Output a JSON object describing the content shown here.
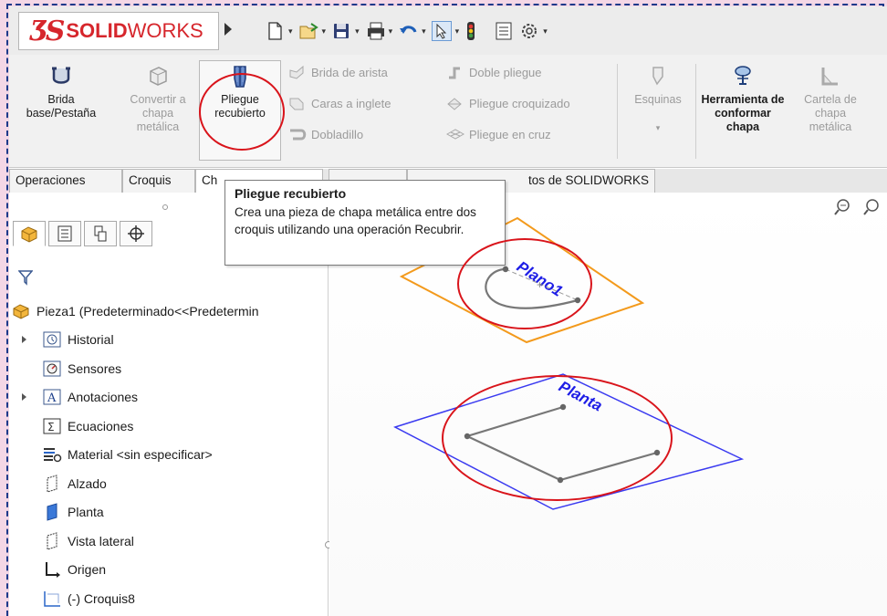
{
  "app": {
    "logo_prefix": "SOLID",
    "logo_suffix": "WORKS"
  },
  "ribbon": {
    "brida_base": "Brida base/Pestaña",
    "convertir": "Convertir a chapa metálica",
    "pliegue_recubierto": "Pliegue recubierto",
    "brida_arista": "Brida de arista",
    "caras_inglete": "Caras a inglete",
    "dobladillo": "Dobladillo",
    "doble_pliegue": "Doble pliegue",
    "pliegue_croquizado": "Pliegue croquizado",
    "pliegue_cruz": "Pliegue en cruz",
    "esquinas": "Esquinas",
    "herramienta": "Herramienta de conformar chapa",
    "cartela": "Cartela de chapa metálica"
  },
  "tabs": {
    "operaciones": "Operaciones",
    "croquis": "Croquis",
    "chapa": "Ch",
    "evaluar": "",
    "complementos": "tos de SOLIDWORKS"
  },
  "tooltip": {
    "title": "Pliegue recubierto",
    "body": "Crea una pieza de chapa metálica entre dos croquis utilizando una operación Recubrir."
  },
  "tree": {
    "root": "Pieza1  (Predeterminado<<Predetermin",
    "items": [
      {
        "label": "Historial",
        "icon": "history-icon",
        "expandable": true
      },
      {
        "label": "Sensores",
        "icon": "sensor-icon",
        "expandable": false
      },
      {
        "label": "Anotaciones",
        "icon": "annotation-icon",
        "expandable": true
      },
      {
        "label": "Ecuaciones",
        "icon": "equation-icon",
        "expandable": false
      },
      {
        "label": "Material <sin especificar>",
        "icon": "material-icon",
        "expandable": false
      },
      {
        "label": "Alzado",
        "icon": "plane-icon",
        "expandable": false
      },
      {
        "label": "Planta",
        "icon": "plane-selected-icon",
        "expandable": false
      },
      {
        "label": "Vista lateral",
        "icon": "plane-icon",
        "expandable": false
      },
      {
        "label": "Origen",
        "icon": "origin-icon",
        "expandable": false
      },
      {
        "label": "(-) Croquis8",
        "icon": "sketch-icon",
        "expandable": false
      }
    ]
  },
  "viewport": {
    "plane_top_label": "Plano1",
    "plane_bottom_label": "Planta"
  },
  "colors": {
    "accent_red": "#d9141b",
    "plane_orange": "#f39a1c",
    "plane_blue": "#3a3af0",
    "label_blue": "#1e1ee6"
  }
}
